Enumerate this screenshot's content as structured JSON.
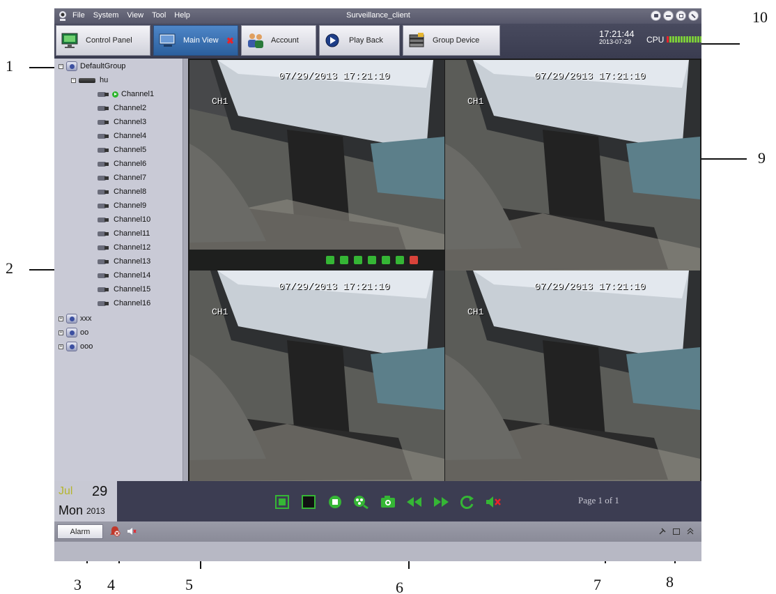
{
  "window": {
    "title": "Surveillance_client",
    "menu": [
      "File",
      "System",
      "View",
      "Tool",
      "Help"
    ]
  },
  "tabs": [
    {
      "label": "Control Panel",
      "icon": "monitor-icon"
    },
    {
      "label": "Main View",
      "icon": "display-icon",
      "active": true,
      "closable": true
    },
    {
      "label": "Account",
      "icon": "users-icon"
    },
    {
      "label": "Play Back",
      "icon": "playback-icon"
    },
    {
      "label": "Group Device",
      "icon": "device-group-icon"
    }
  ],
  "status_top": {
    "time": "17:21:44",
    "date": "2013-07-29",
    "cpu_label": "CPU"
  },
  "tree": {
    "root": "DefaultGroup",
    "device": "hu",
    "channels": [
      "Channel1",
      "Channel2",
      "Channel3",
      "Channel4",
      "Channel5",
      "Channel6",
      "Channel7",
      "Channel8",
      "Channel9",
      "Channel10",
      "Channel11",
      "Channel12",
      "Channel13",
      "Channel14",
      "Channel15",
      "Channel16"
    ],
    "other_groups": [
      "xxx",
      "oo",
      "ooo"
    ]
  },
  "video": {
    "osd_time": "07/29/2013 17:21:10",
    "osd_channel": "CH1"
  },
  "calendar": {
    "month": "Jul",
    "day": "29",
    "weekday": "Mon",
    "year": "2013"
  },
  "pager": {
    "label": "Page 1 of 1"
  },
  "statusbar": {
    "alarm_button": "Alarm"
  },
  "annotations": [
    "1",
    "2",
    "3",
    "4",
    "5",
    "6",
    "7",
    "8",
    "9",
    "10"
  ],
  "colors": {
    "accent": "#2b5f9e",
    "ok": "#35b635",
    "alert": "#e8232a",
    "selected_pane": "#c9b735"
  }
}
